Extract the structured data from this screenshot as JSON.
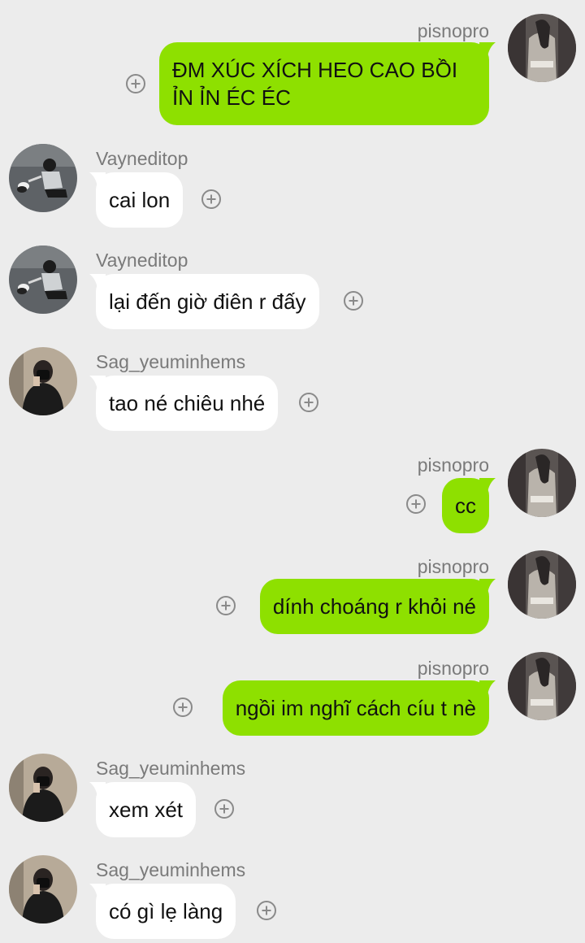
{
  "colors": {
    "background": "#ececec",
    "outgoing_bubble": "#8ee000",
    "incoming_bubble": "#ffffff",
    "sender_name": "#7a7a7a",
    "text": "#111111"
  },
  "add_reaction_icon": "circle-plus-icon",
  "messages": [
    {
      "direction": "outgoing",
      "sender": "pisnopro",
      "text": "ĐM XÚC XÍCH HEO CAO BỒI ỈN ỈN ÉC ÉC"
    },
    {
      "direction": "incoming",
      "sender": "Vayneditop",
      "text": "cai lon"
    },
    {
      "direction": "incoming",
      "sender": "Vayneditop",
      "text": "lại đến giờ điên r đấy"
    },
    {
      "direction": "incoming",
      "sender": "Sag_yeuminhems",
      "text": "tao né chiêu nhé"
    },
    {
      "direction": "outgoing",
      "sender": "pisnopro",
      "text": "cc"
    },
    {
      "direction": "outgoing",
      "sender": "pisnopro",
      "text": "dính choáng r khỏi né"
    },
    {
      "direction": "outgoing",
      "sender": "pisnopro",
      "text": "ngồi im nghĩ cách cíu t nè"
    },
    {
      "direction": "incoming",
      "sender": "Sag_yeuminhems",
      "text": "xem xét"
    },
    {
      "direction": "incoming",
      "sender": "Sag_yeuminhems",
      "text": "có gì lẹ làng"
    }
  ]
}
